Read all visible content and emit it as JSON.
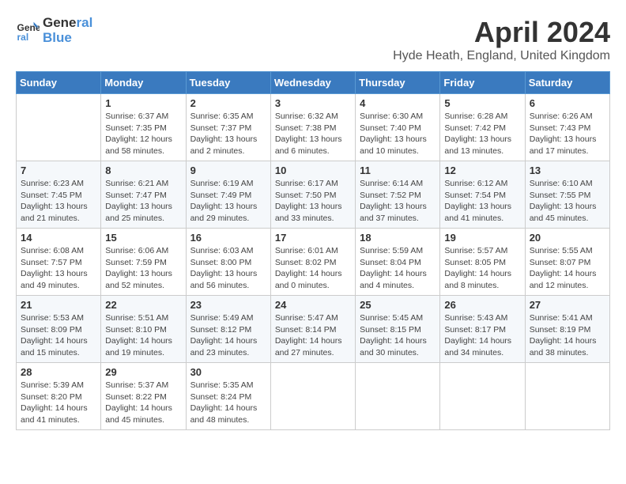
{
  "header": {
    "logo_line1": "General",
    "logo_line2": "Blue",
    "month": "April 2024",
    "location": "Hyde Heath, England, United Kingdom"
  },
  "weekdays": [
    "Sunday",
    "Monday",
    "Tuesday",
    "Wednesday",
    "Thursday",
    "Friday",
    "Saturday"
  ],
  "weeks": [
    [
      {
        "day": "",
        "info": ""
      },
      {
        "day": "1",
        "info": "Sunrise: 6:37 AM\nSunset: 7:35 PM\nDaylight: 12 hours\nand 58 minutes."
      },
      {
        "day": "2",
        "info": "Sunrise: 6:35 AM\nSunset: 7:37 PM\nDaylight: 13 hours\nand 2 minutes."
      },
      {
        "day": "3",
        "info": "Sunrise: 6:32 AM\nSunset: 7:38 PM\nDaylight: 13 hours\nand 6 minutes."
      },
      {
        "day": "4",
        "info": "Sunrise: 6:30 AM\nSunset: 7:40 PM\nDaylight: 13 hours\nand 10 minutes."
      },
      {
        "day": "5",
        "info": "Sunrise: 6:28 AM\nSunset: 7:42 PM\nDaylight: 13 hours\nand 13 minutes."
      },
      {
        "day": "6",
        "info": "Sunrise: 6:26 AM\nSunset: 7:43 PM\nDaylight: 13 hours\nand 17 minutes."
      }
    ],
    [
      {
        "day": "7",
        "info": "Sunrise: 6:23 AM\nSunset: 7:45 PM\nDaylight: 13 hours\nand 21 minutes."
      },
      {
        "day": "8",
        "info": "Sunrise: 6:21 AM\nSunset: 7:47 PM\nDaylight: 13 hours\nand 25 minutes."
      },
      {
        "day": "9",
        "info": "Sunrise: 6:19 AM\nSunset: 7:49 PM\nDaylight: 13 hours\nand 29 minutes."
      },
      {
        "day": "10",
        "info": "Sunrise: 6:17 AM\nSunset: 7:50 PM\nDaylight: 13 hours\nand 33 minutes."
      },
      {
        "day": "11",
        "info": "Sunrise: 6:14 AM\nSunset: 7:52 PM\nDaylight: 13 hours\nand 37 minutes."
      },
      {
        "day": "12",
        "info": "Sunrise: 6:12 AM\nSunset: 7:54 PM\nDaylight: 13 hours\nand 41 minutes."
      },
      {
        "day": "13",
        "info": "Sunrise: 6:10 AM\nSunset: 7:55 PM\nDaylight: 13 hours\nand 45 minutes."
      }
    ],
    [
      {
        "day": "14",
        "info": "Sunrise: 6:08 AM\nSunset: 7:57 PM\nDaylight: 13 hours\nand 49 minutes."
      },
      {
        "day": "15",
        "info": "Sunrise: 6:06 AM\nSunset: 7:59 PM\nDaylight: 13 hours\nand 52 minutes."
      },
      {
        "day": "16",
        "info": "Sunrise: 6:03 AM\nSunset: 8:00 PM\nDaylight: 13 hours\nand 56 minutes."
      },
      {
        "day": "17",
        "info": "Sunrise: 6:01 AM\nSunset: 8:02 PM\nDaylight: 14 hours\nand 0 minutes."
      },
      {
        "day": "18",
        "info": "Sunrise: 5:59 AM\nSunset: 8:04 PM\nDaylight: 14 hours\nand 4 minutes."
      },
      {
        "day": "19",
        "info": "Sunrise: 5:57 AM\nSunset: 8:05 PM\nDaylight: 14 hours\nand 8 minutes."
      },
      {
        "day": "20",
        "info": "Sunrise: 5:55 AM\nSunset: 8:07 PM\nDaylight: 14 hours\nand 12 minutes."
      }
    ],
    [
      {
        "day": "21",
        "info": "Sunrise: 5:53 AM\nSunset: 8:09 PM\nDaylight: 14 hours\nand 15 minutes."
      },
      {
        "day": "22",
        "info": "Sunrise: 5:51 AM\nSunset: 8:10 PM\nDaylight: 14 hours\nand 19 minutes."
      },
      {
        "day": "23",
        "info": "Sunrise: 5:49 AM\nSunset: 8:12 PM\nDaylight: 14 hours\nand 23 minutes."
      },
      {
        "day": "24",
        "info": "Sunrise: 5:47 AM\nSunset: 8:14 PM\nDaylight: 14 hours\nand 27 minutes."
      },
      {
        "day": "25",
        "info": "Sunrise: 5:45 AM\nSunset: 8:15 PM\nDaylight: 14 hours\nand 30 minutes."
      },
      {
        "day": "26",
        "info": "Sunrise: 5:43 AM\nSunset: 8:17 PM\nDaylight: 14 hours\nand 34 minutes."
      },
      {
        "day": "27",
        "info": "Sunrise: 5:41 AM\nSunset: 8:19 PM\nDaylight: 14 hours\nand 38 minutes."
      }
    ],
    [
      {
        "day": "28",
        "info": "Sunrise: 5:39 AM\nSunset: 8:20 PM\nDaylight: 14 hours\nand 41 minutes."
      },
      {
        "day": "29",
        "info": "Sunrise: 5:37 AM\nSunset: 8:22 PM\nDaylight: 14 hours\nand 45 minutes."
      },
      {
        "day": "30",
        "info": "Sunrise: 5:35 AM\nSunset: 8:24 PM\nDaylight: 14 hours\nand 48 minutes."
      },
      {
        "day": "",
        "info": ""
      },
      {
        "day": "",
        "info": ""
      },
      {
        "day": "",
        "info": ""
      },
      {
        "day": "",
        "info": ""
      }
    ]
  ]
}
